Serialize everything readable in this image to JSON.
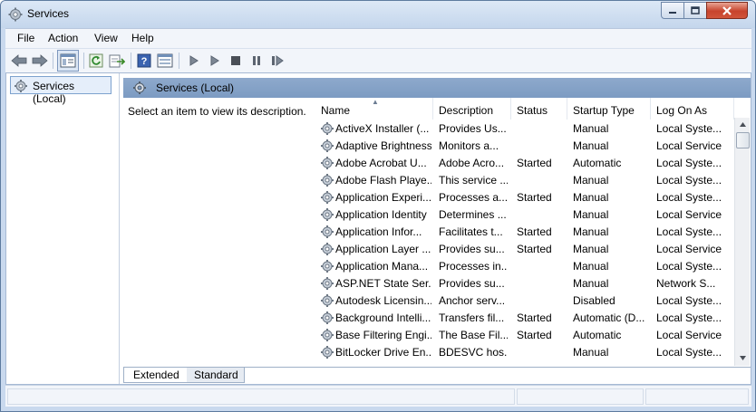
{
  "window": {
    "title": "Services"
  },
  "menu": [
    "File",
    "Action",
    "View",
    "Help"
  ],
  "toolbar": {
    "icons": [
      "back-arrow-icon",
      "forward-arrow-icon",
      "show-hide-console-tree-icon",
      "refresh-icon",
      "export-list-icon",
      "help-icon",
      "properties-icon",
      "play-icon",
      "play-icon",
      "stop-icon",
      "pause-icon",
      "restart-icon"
    ]
  },
  "tree": {
    "root_label": "Services (Local)"
  },
  "pane": {
    "header": "Services (Local)",
    "description_prompt": "Select an item to view its description."
  },
  "columns": [
    "Name",
    "Description",
    "Status",
    "Startup Type",
    "Log On As"
  ],
  "services": [
    {
      "name": "ActiveX Installer (...",
      "description": "Provides Us...",
      "status": "",
      "startup": "Manual",
      "logon": "Local Syste..."
    },
    {
      "name": "Adaptive Brightness",
      "description": "Monitors a...",
      "status": "",
      "startup": "Manual",
      "logon": "Local Service"
    },
    {
      "name": "Adobe Acrobat U...",
      "description": "Adobe Acro...",
      "status": "Started",
      "startup": "Automatic",
      "logon": "Local Syste..."
    },
    {
      "name": "Adobe Flash Playe...",
      "description": "This service ...",
      "status": "",
      "startup": "Manual",
      "logon": "Local Syste..."
    },
    {
      "name": "Application Experi...",
      "description": "Processes a...",
      "status": "Started",
      "startup": "Manual",
      "logon": "Local Syste..."
    },
    {
      "name": "Application Identity",
      "description": "Determines ...",
      "status": "",
      "startup": "Manual",
      "logon": "Local Service"
    },
    {
      "name": "Application Infor...",
      "description": "Facilitates t...",
      "status": "Started",
      "startup": "Manual",
      "logon": "Local Syste..."
    },
    {
      "name": "Application Layer ...",
      "description": "Provides su...",
      "status": "Started",
      "startup": "Manual",
      "logon": "Local Service"
    },
    {
      "name": "Application Mana...",
      "description": "Processes in...",
      "status": "",
      "startup": "Manual",
      "logon": "Local Syste..."
    },
    {
      "name": "ASP.NET State Ser...",
      "description": "Provides su...",
      "status": "",
      "startup": "Manual",
      "logon": "Network S..."
    },
    {
      "name": "Autodesk Licensin...",
      "description": "Anchor serv...",
      "status": "",
      "startup": "Disabled",
      "logon": "Local Syste..."
    },
    {
      "name": "Background Intelli...",
      "description": "Transfers fil...",
      "status": "Started",
      "startup": "Automatic (D...",
      "logon": "Local Syste..."
    },
    {
      "name": "Base Filtering Engi...",
      "description": "The Base Fil...",
      "status": "Started",
      "startup": "Automatic",
      "logon": "Local Service"
    },
    {
      "name": "BitLocker Drive En...",
      "description": "BDESVC hos...",
      "status": "",
      "startup": "Manual",
      "logon": "Local Syste..."
    }
  ],
  "tabs": [
    "Extended",
    "Standard"
  ],
  "colors": {
    "accent": "#7c9bc2",
    "frame": "#c9d9ee"
  }
}
